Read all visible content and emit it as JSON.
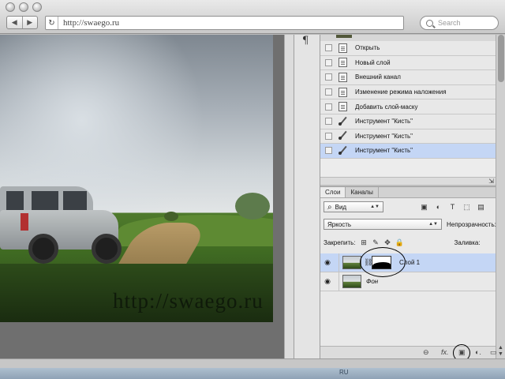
{
  "browser": {
    "url": "http://swaego.ru",
    "search_placeholder": "Search",
    "back_glyph": "◀",
    "forward_glyph": "▶",
    "reload_glyph": "↻"
  },
  "canvas": {
    "watermark": "http://swaego.ru"
  },
  "tool_strip": {
    "paragraph_glyph": "¶"
  },
  "history": {
    "items": [
      {
        "label": "Открыть",
        "icon": "document-icon"
      },
      {
        "label": "Новый слой",
        "icon": "document-icon"
      },
      {
        "label": "Внешний канал",
        "icon": "document-icon"
      },
      {
        "label": "Изменение режима наложения",
        "icon": "document-icon"
      },
      {
        "label": "Добавить слой-маску",
        "icon": "document-icon"
      },
      {
        "label": "Инструмент \"Кисть\"",
        "icon": "brush-icon"
      },
      {
        "label": "Инструмент \"Кисть\"",
        "icon": "brush-icon"
      },
      {
        "label": "Инструмент \"Кисть\"",
        "icon": "brush-icon"
      }
    ],
    "active_index": 7
  },
  "layers": {
    "tabs": [
      "Слои",
      "Каналы"
    ],
    "filter_label": "Вид",
    "blend_mode": "Яркость",
    "opacity_label": "Непрозрачность:",
    "lock_label": "Закрепить:",
    "fill_label": "Заливка:",
    "rows": [
      {
        "name": "Слой 1",
        "active": true,
        "has_mask": true
      },
      {
        "name": "Фон",
        "active": false,
        "has_mask": false
      }
    ],
    "footer_fx": "fx."
  },
  "taskbar": {
    "text": "RU"
  }
}
